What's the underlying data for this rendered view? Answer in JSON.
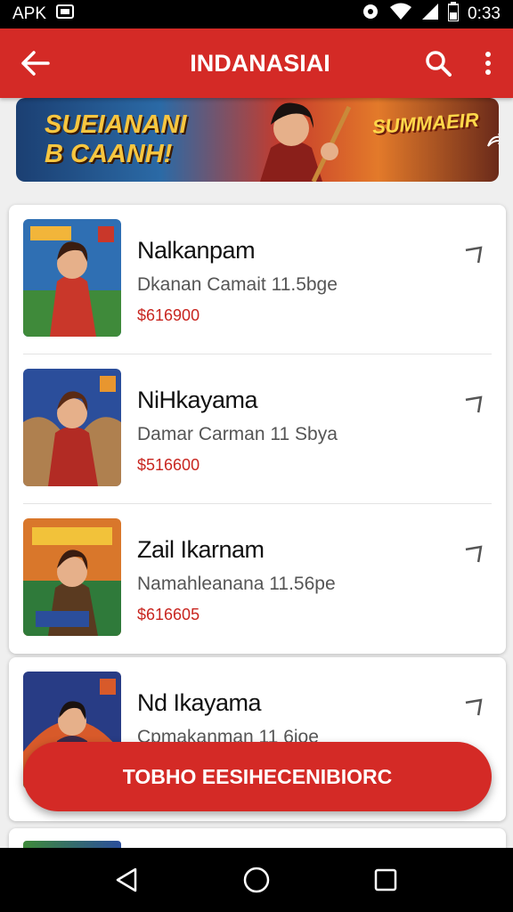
{
  "status_bar": {
    "left_text": "APK",
    "time": "0:33",
    "icons": [
      "cast-icon",
      "sync-icon",
      "wifi-icon",
      "signal-icon",
      "battery-icon"
    ]
  },
  "app_bar": {
    "title": "INDANASIAI",
    "icons": [
      "back-arrow-icon",
      "search-icon",
      "more-vert-icon"
    ]
  },
  "banner": {
    "headline_line1": "SUEIANANI",
    "headline_line2": "B CAANH!",
    "logo_text_line1": "SUMMAEIR",
    "logo_text_line2": "",
    "share_icon": "share-icon"
  },
  "items": [
    {
      "title": "Nalkanpam",
      "subtitle": "Dkanan Camait 11.5bge",
      "price": "$616900",
      "thumb_colors": [
        "#2f6fb3",
        "#c9372a",
        "#f2b53a"
      ]
    },
    {
      "title": "NiHkayama",
      "subtitle": "Damar Carman 11 Sbya",
      "price": "$516600",
      "thumb_colors": [
        "#2b4e9b",
        "#b22b24",
        "#e8962f"
      ]
    },
    {
      "title": "Zail Ikarnam",
      "subtitle": "Namahleanana 11.56pe",
      "price": "$616605",
      "thumb_colors": [
        "#d9772b",
        "#2f7a3a",
        "#f2c23a"
      ]
    },
    {
      "title": "Nd Ikayama",
      "subtitle": "Cpmakanman 11 6ioe",
      "price": "",
      "thumb_colors": [
        "#283c85",
        "#d85a2a",
        "#5aa0d9"
      ]
    }
  ],
  "cta": {
    "label": "TOBHO EESIHECENIBIORC"
  },
  "nav_bar": {
    "icons": [
      "nav-back-icon",
      "nav-home-icon",
      "nav-recents-icon"
    ]
  },
  "colors": {
    "primary": "#d42a26",
    "price": "#c8251f",
    "background": "#efefef"
  }
}
